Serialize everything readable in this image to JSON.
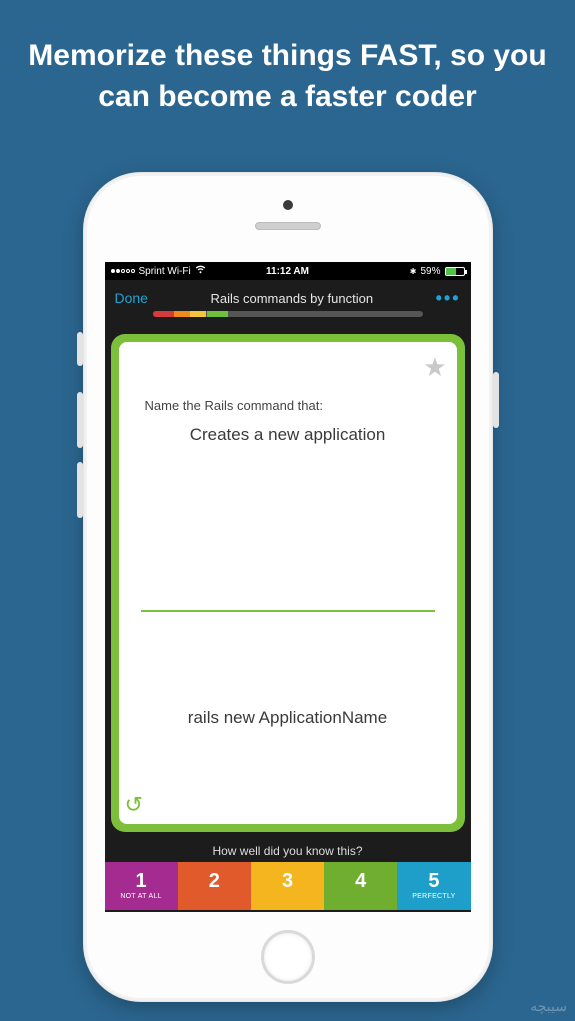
{
  "headline": "Memorize these things FAST, so you can become a faster coder",
  "status": {
    "carrier": "Sprint Wi-Fi",
    "time": "11:12 AM",
    "battery_pct": "59%",
    "battery_fill_pct": 59,
    "bt_icon": "✱"
  },
  "nav": {
    "done": "Done",
    "title": "Rails commands by function",
    "more": "•••"
  },
  "card": {
    "prompt": "Name the Rails command that:",
    "question": "Creates a new application",
    "answer": "rails new ApplicationName",
    "star_glyph": "★",
    "undo_glyph": "↺"
  },
  "footer": {
    "question": "How well did you know this?",
    "ratings": [
      {
        "num": "1",
        "sub": "NOT AT ALL"
      },
      {
        "num": "2",
        "sub": ""
      },
      {
        "num": "3",
        "sub": ""
      },
      {
        "num": "4",
        "sub": ""
      },
      {
        "num": "5",
        "sub": "PERFECTLY"
      }
    ]
  },
  "watermark": {
    "apple": "",
    "text": "سیبچه"
  }
}
